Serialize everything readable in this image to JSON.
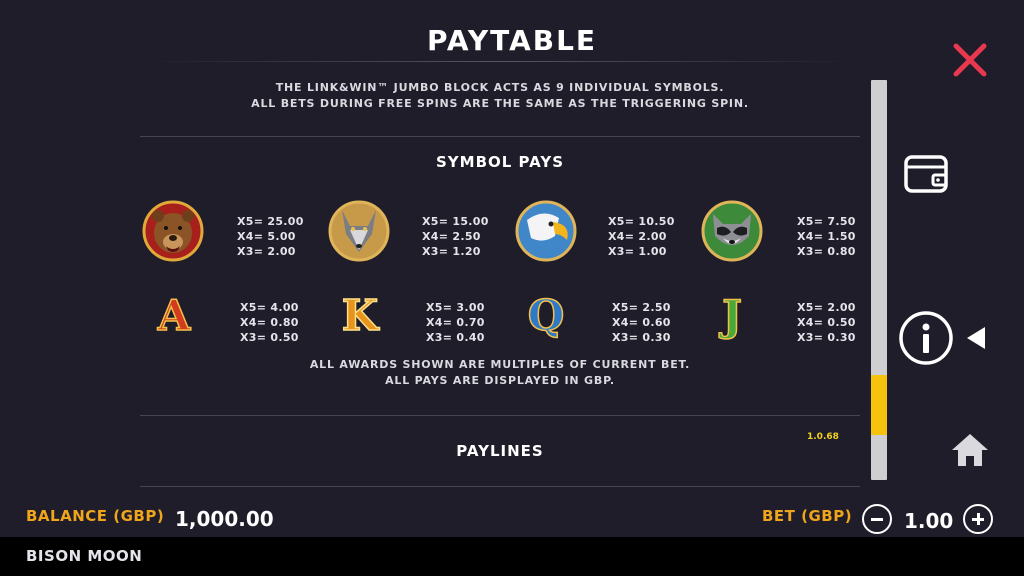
{
  "header": {
    "title": "PAYTABLE"
  },
  "intro": {
    "line1": "THE LINK&WIN™ JUMBO BLOCK ACTS AS 9 INDIVIDUAL SYMBOLS.",
    "line2": "ALL BETS DURING FREE SPINS ARE THE SAME AS THE TRIGGERING SPIN."
  },
  "symbol_pays": {
    "title": "SYMBOL PAYS",
    "high": [
      {
        "icon": "bear-icon",
        "x5": "X5= 25.00",
        "x4": "X4= 5.00",
        "x3": "X3= 2.00"
      },
      {
        "icon": "wolf-icon",
        "x5": "X5= 15.00",
        "x4": "X4= 2.50",
        "x3": "X3= 1.20"
      },
      {
        "icon": "eagle-icon",
        "x5": "X5= 10.50",
        "x4": "X4= 2.00",
        "x3": "X3= 1.00"
      },
      {
        "icon": "raccoon-icon",
        "x5": "X5= 7.50",
        "x4": "X4= 1.50",
        "x3": "X3= 0.80"
      }
    ],
    "low": [
      {
        "letter": "A",
        "color": "#d23b1e",
        "x5": "X5= 4.00",
        "x4": "X4= 0.80",
        "x3": "X3= 0.50"
      },
      {
        "letter": "K",
        "color": "#e8941c",
        "x5": "X5= 3.00",
        "x4": "X4= 0.70",
        "x3": "X3= 0.40"
      },
      {
        "letter": "Q",
        "color": "#2f79c9",
        "x5": "X5= 2.50",
        "x4": "X4= 0.60",
        "x3": "X3= 0.30"
      },
      {
        "letter": "J",
        "color": "#49a83a",
        "x5": "X5= 2.00",
        "x4": "X4= 0.50",
        "x3": "X3= 0.30"
      }
    ],
    "note1": "ALL AWARDS SHOWN ARE MULTIPLES OF CURRENT BET.",
    "note2": "ALL PAYS ARE DISPLAYED IN GBP."
  },
  "paylines": {
    "title": "PAYLINES"
  },
  "version": "1.0.68",
  "sidebar": {
    "close_icon": "close-icon",
    "wallet_icon": "wallet-icon",
    "info_icon": "info-icon",
    "home_icon": "home-icon"
  },
  "footer": {
    "balance_label": "BALANCE (GBP)",
    "balance_value": "1,000.00",
    "bet_label": "BET (GBP)",
    "bet_value": "1.00",
    "game_name": "BISON MOON"
  },
  "colors": {
    "background": "#1e1d29",
    "accent_gold": "#f0a51b",
    "close_red": "#e8384f",
    "scroll_thumb": "#f5c20d",
    "version_yellow": "#f2d11c"
  },
  "scroll": {
    "position_fraction": 0.74
  }
}
